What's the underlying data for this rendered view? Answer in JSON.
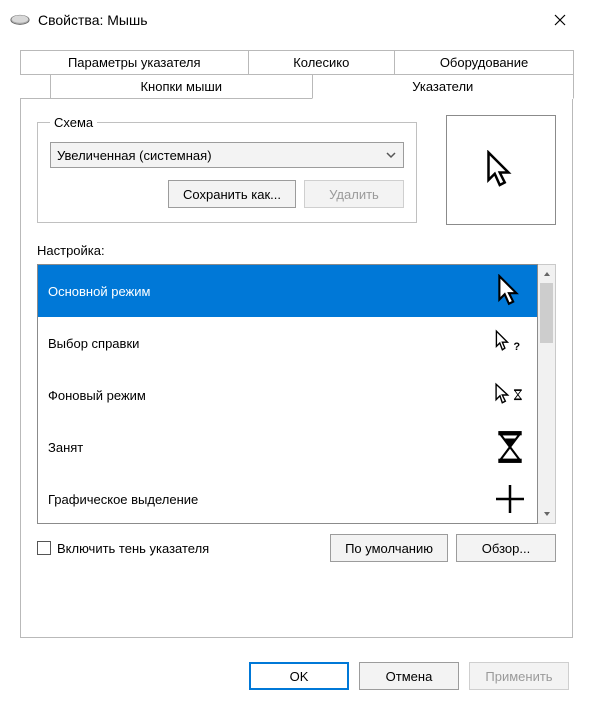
{
  "window": {
    "title": "Свойства: Мышь"
  },
  "tabs": {
    "row1": [
      "Параметры указателя",
      "Колесико",
      "Оборудование"
    ],
    "row2": [
      "Кнопки мыши",
      "Указатели"
    ],
    "active": "Указатели"
  },
  "scheme": {
    "legend": "Схема",
    "selected": "Увеличенная (системная)",
    "save_as": "Сохранить как...",
    "delete": "Удалить"
  },
  "customize_label": "Настройка:",
  "cursors": [
    {
      "label": "Основной режим",
      "icon": "arrow",
      "selected": true
    },
    {
      "label": "Выбор справки",
      "icon": "arrow-help",
      "selected": false
    },
    {
      "label": "Фоновый режим",
      "icon": "arrow-hourglass",
      "selected": false
    },
    {
      "label": "Занят",
      "icon": "hourglass",
      "selected": false
    },
    {
      "label": "Графическое выделение",
      "icon": "crosshair",
      "selected": false
    }
  ],
  "shadow_checkbox": "Включить тень указателя",
  "defaults_btn": "По умолчанию",
  "browse_btn": "Обзор...",
  "footer": {
    "ok": "OK",
    "cancel": "Отмена",
    "apply": "Применить"
  }
}
